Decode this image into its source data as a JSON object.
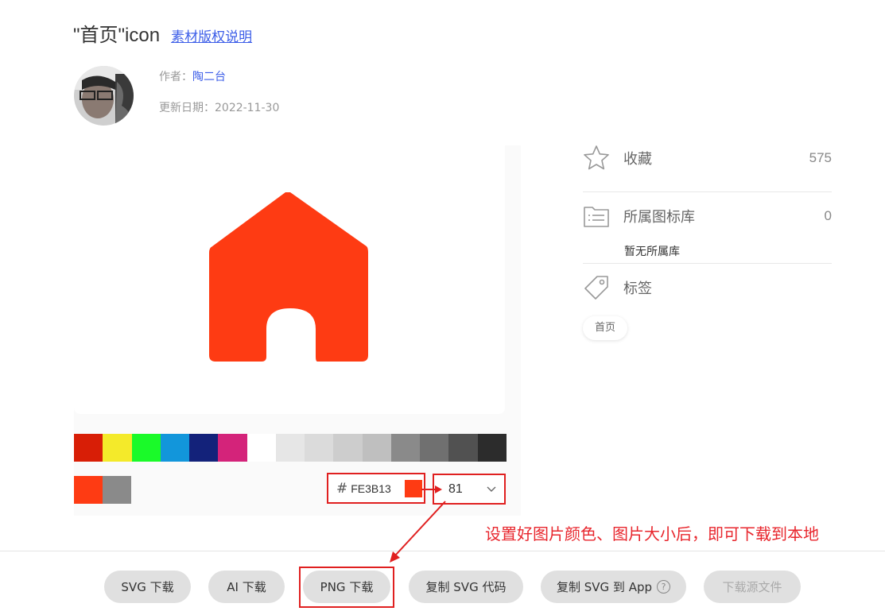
{
  "header": {
    "title": "\"首页\"icon",
    "copyright_link": "素材版权说明"
  },
  "meta": {
    "author_label": "作者：",
    "author_name": "陶二台",
    "date_label": "更新日期：",
    "date_value": "2022-11-30"
  },
  "preview": {
    "icon": "house-icon",
    "icon_color": "#FE3B13",
    "palette": [
      "#d81e06",
      "#f4ea2a",
      "#1afa29",
      "#1296db",
      "#13227a",
      "#d4237a",
      "#ffffff",
      "#e6e6e6",
      "#dbdbdb",
      "#cdcdcd",
      "#bfbfbf",
      "#8a8a8a",
      "#707070",
      "#515151",
      "#2c2c2c"
    ],
    "recent_colors": [
      "#FE3B13",
      "#8a8a8a"
    ],
    "hash": "#",
    "hex_value": "FE3B13",
    "size_value": "81"
  },
  "sidebar": {
    "favorite_label": "收藏",
    "favorite_count": "575",
    "library_label": "所属图标库",
    "library_count": "0",
    "no_library": "暂无所属库",
    "tag_label": "标签",
    "tag": "首页"
  },
  "annotation": "设置好图片颜色、图片大小后，即可下载到本地",
  "buttons": {
    "svg_download": "SVG 下载",
    "ai_download": "AI 下载",
    "png_download": "PNG 下载",
    "copy_svg_code": "复制 SVG 代码",
    "copy_svg_app": "复制 SVG 到 App",
    "help": "?",
    "download_source": "下载源文件"
  },
  "colors": {
    "accent_link": "#3d5ee8",
    "highlight_red": "#e02020"
  }
}
